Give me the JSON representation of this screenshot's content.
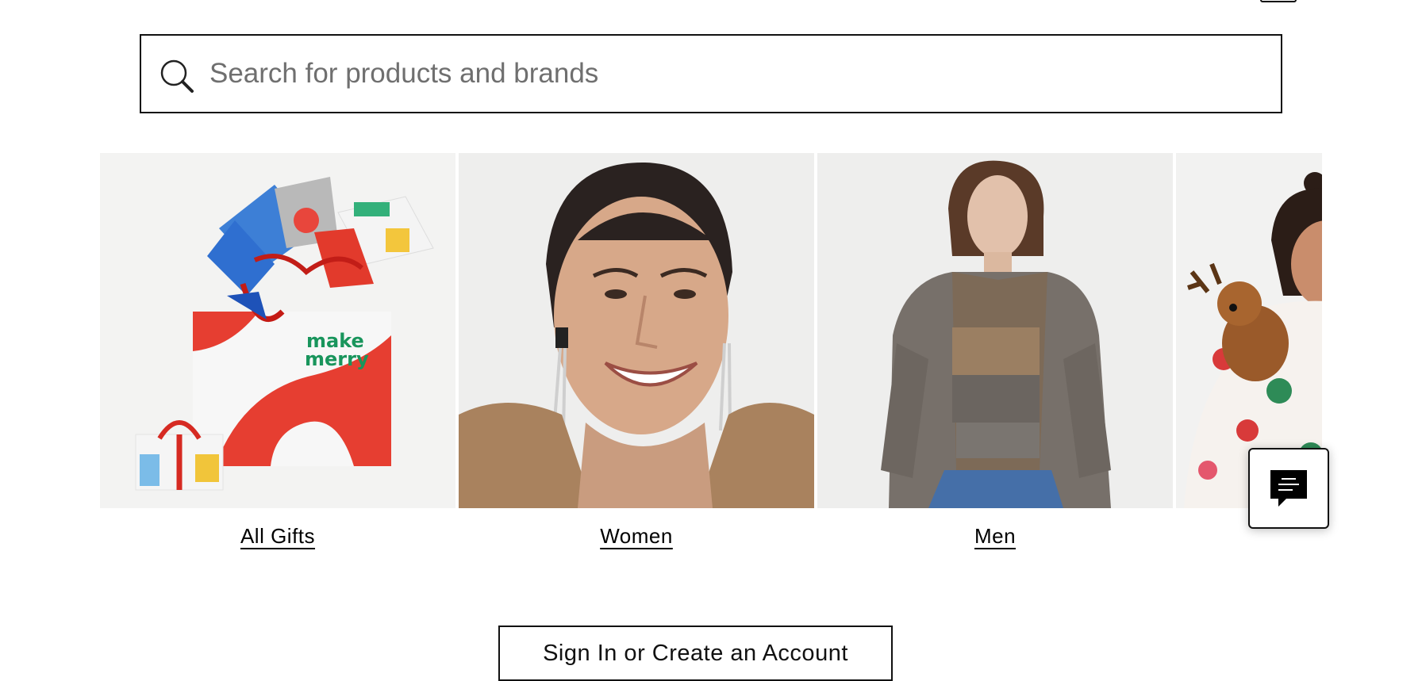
{
  "search": {
    "placeholder": "Search for products and brands",
    "value": ""
  },
  "categories": [
    {
      "label": "All Gifts",
      "image": "gift-bag-with-presents"
    },
    {
      "label": "Women",
      "image": "smiling-woman-in-fur-coat"
    },
    {
      "label": "Men",
      "image": "man-in-grey-coat-and-sweater"
    },
    {
      "label": "",
      "image": "child-in-floral-pajamas-with-reindeer-toy"
    }
  ],
  "chat": {
    "icon": "chat-bubble-icon"
  },
  "account": {
    "signin_label": "Sign In or Create an Account"
  },
  "colors": {
    "border": "#111111",
    "background": "#ffffff",
    "placeholder": "#6f6f6f"
  }
}
